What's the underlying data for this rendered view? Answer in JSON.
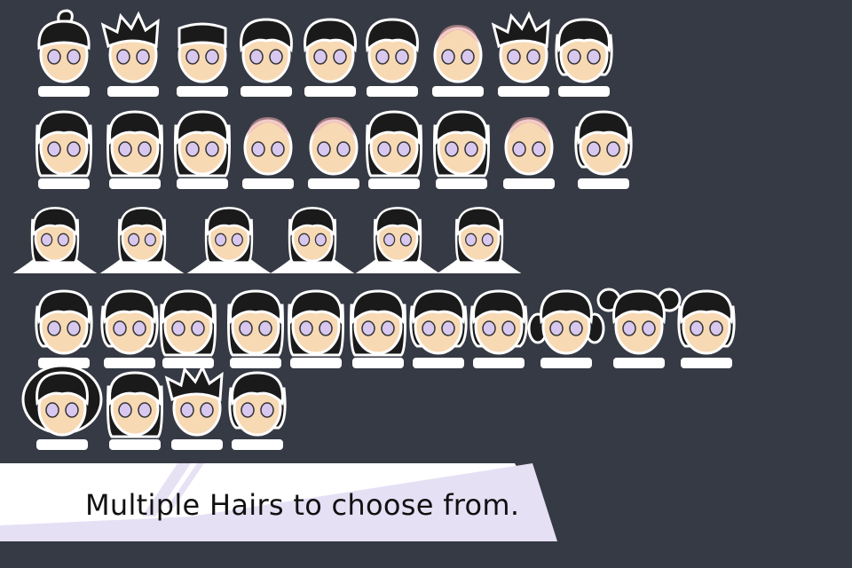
{
  "caption": "Multiple Hairs to choose from.",
  "colors": {
    "background": "#363a45",
    "skin": "#f7d9b4",
    "hair": "#1a1a1a",
    "eye": "#d8c8ef",
    "outline": "#ffffff",
    "shirt": "#ffffff",
    "banner_fill": "#ffffff",
    "banner_accent": "#e2dcf2"
  },
  "rows": [
    {
      "style": "bust",
      "count": 9
    },
    {
      "style": "bust",
      "count": 9
    },
    {
      "style": "arms",
      "count": 6
    },
    {
      "style": "bust",
      "count": 11
    },
    {
      "style": "bust",
      "count": 4
    }
  ]
}
